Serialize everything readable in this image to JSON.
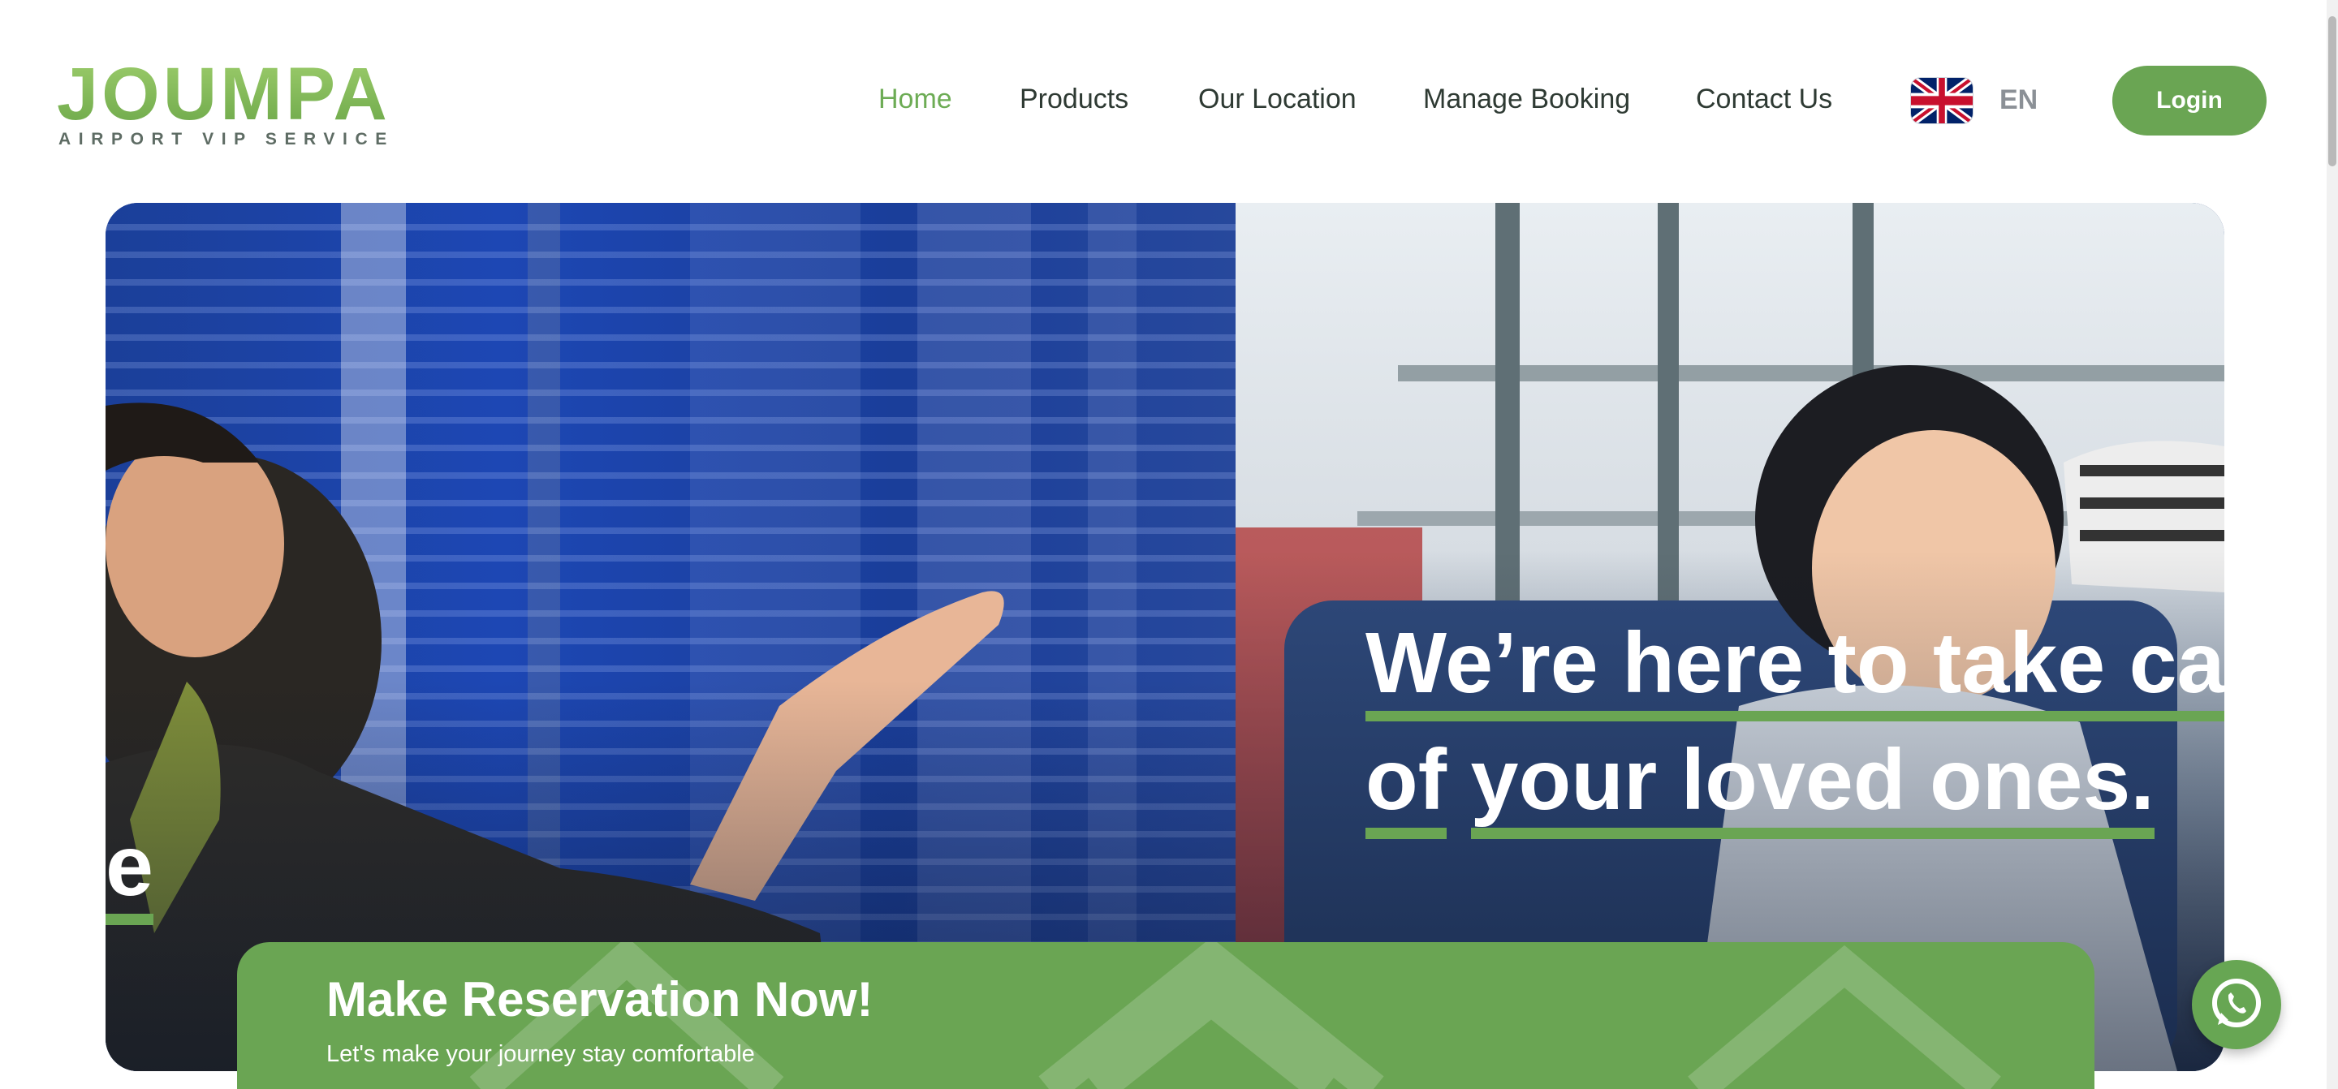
{
  "brand": {
    "name": "JOUMPA",
    "tagline": "AIRPORT VIP SERVICE"
  },
  "nav": {
    "items": [
      {
        "label": "Home",
        "active": true
      },
      {
        "label": "Products",
        "active": false
      },
      {
        "label": "Our Location",
        "active": false
      },
      {
        "label": "Manage Booking",
        "active": false
      },
      {
        "label": "Contact Us",
        "active": false
      }
    ],
    "language": {
      "code": "EN",
      "flag": "uk-flag-icon"
    },
    "login_label": "Login"
  },
  "hero": {
    "left_fragment": "e",
    "line1": "We’re here to take care",
    "line2_part1": "of",
    "line2_part2": "your loved ones."
  },
  "reservation": {
    "title": "Make Reservation Now!",
    "subtitle": "Let's make your journey stay comfortable"
  },
  "colors": {
    "accent": "#6aa553",
    "nav_text": "#2e3a33",
    "active_nav": "#6dac55",
    "lang_text": "#8b9096"
  },
  "whatsapp": {
    "icon": "whatsapp-icon"
  }
}
